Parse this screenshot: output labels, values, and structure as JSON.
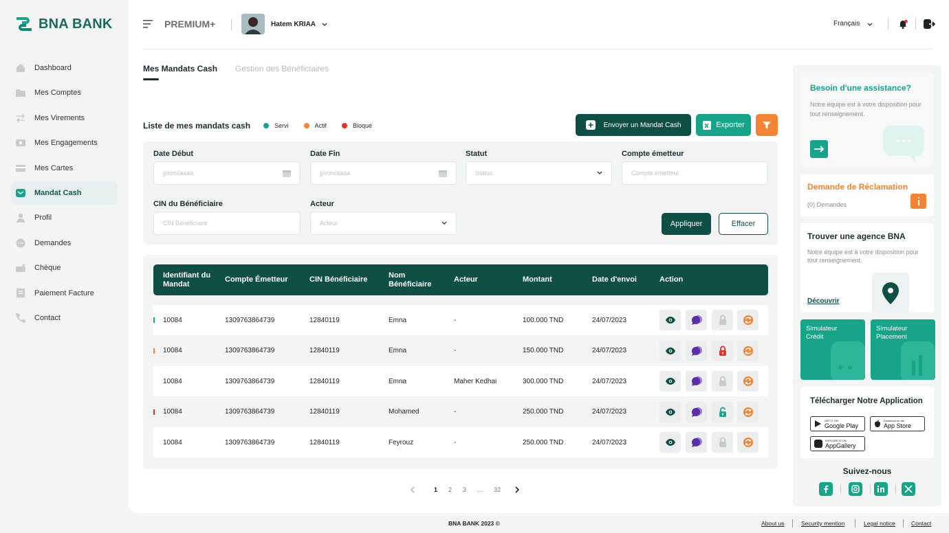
{
  "brand": {
    "name": "BNA BANK",
    "color": "#17a589",
    "dark": "#0d4f44",
    "orange": "#f28433"
  },
  "sidebar": {
    "items": [
      {
        "label": "Dashboard",
        "icon": "home-icon",
        "active": false
      },
      {
        "label": "Mes Comptes",
        "icon": "folder-icon",
        "active": false
      },
      {
        "label": "Mes Virements",
        "icon": "transfer-icon",
        "active": false
      },
      {
        "label": "Mes Engagements",
        "icon": "engagement-icon",
        "active": false
      },
      {
        "label": "Mes Cartes",
        "icon": "card-icon",
        "active": false
      },
      {
        "label": "Mandat Cash",
        "icon": "envelope-icon",
        "active": true
      },
      {
        "label": "Profil",
        "icon": "user-icon",
        "active": false
      },
      {
        "label": "Demandes",
        "icon": "chat-icon",
        "active": false
      },
      {
        "label": "Chèque",
        "icon": "cheque-icon",
        "active": false
      },
      {
        "label": "Paiement Facture",
        "icon": "invoice-icon",
        "active": false
      },
      {
        "label": "Contact",
        "icon": "phone-icon",
        "active": false
      }
    ]
  },
  "header": {
    "plan": "PREMIUM+",
    "user_name": "Hatem KRIAA",
    "language": "Français"
  },
  "tabs": [
    {
      "label": "Mes Mandats Cash",
      "active": true
    },
    {
      "label": "Gestion des Bénéficiaires",
      "active": false
    }
  ],
  "list": {
    "title": "Liste de mes mandats cash",
    "legend": [
      {
        "label": "Servi",
        "color": "#17a589"
      },
      {
        "label": "Actif",
        "color": "#f28433"
      },
      {
        "label": "Bloqué",
        "color": "#e5302f"
      }
    ],
    "send_button": "Envoyer un Mandat Cash",
    "export_button": "Exporter"
  },
  "filters": {
    "date_debut": {
      "label": "Date Début",
      "placeholder": "jj/mm/aaaa"
    },
    "date_fin": {
      "label": "Date Fin",
      "placeholder": "jj/mm/aaaa"
    },
    "statut": {
      "label": "Statut",
      "placeholder": "Status"
    },
    "compte": {
      "label": "Compte émetteur",
      "placeholder": "Compte émetteur"
    },
    "cin": {
      "label": "CIN du Bénéficiaire",
      "placeholder": "CIN Bénéficiaire"
    },
    "acteur": {
      "label": "Acteur",
      "placeholder": "Acteur"
    },
    "apply": "Appliquer",
    "clear": "Effacer"
  },
  "table": {
    "headers": [
      "Identifiant du Mandat",
      "Compte Émetteur",
      "CIN Bénéficiaire",
      "Nom Bénéficiaire",
      "Acteur",
      "Montant",
      "Date d'envoi",
      "Action"
    ],
    "rows": [
      {
        "id": "10084",
        "compte": "1309763864739",
        "cin": "12840119",
        "nom": "Emna",
        "acteur": "-",
        "montant": "100.000 TND",
        "date": "24/07/2023",
        "status": "servi",
        "lock": "disabled"
      },
      {
        "id": "10084",
        "compte": "1309763864739",
        "cin": "12840119",
        "nom": "Emna",
        "acteur": "-",
        "montant": "150.000 TND",
        "date": "24/07/2023",
        "status": "actif",
        "lock": "locked"
      },
      {
        "id": "10084",
        "compte": "1309763864739",
        "cin": "12840119",
        "nom": "Emna",
        "acteur": "Maher Kedhai",
        "montant": "300.000 TND",
        "date": "24/07/2023",
        "status": "none",
        "lock": "disabled"
      },
      {
        "id": "10084",
        "compte": "1309763864739",
        "cin": "12840119",
        "nom": "Mohamed",
        "acteur": "-",
        "montant": "250.000 TND",
        "date": "24/07/2023",
        "status": "bloque",
        "lock": "unlocked"
      },
      {
        "id": "10084",
        "compte": "1309763864739",
        "cin": "12840119",
        "nom": "Feyrouz",
        "acteur": "-",
        "montant": "250.000 TND",
        "date": "24/07/2023",
        "status": "none",
        "lock": "disabled"
      }
    ]
  },
  "pagination": {
    "pages": [
      "1",
      "2",
      "3",
      "...",
      "32"
    ],
    "current": "1"
  },
  "assist": {
    "title": "Besoin d'une assistance?",
    "text": "Notre équipe est à votre disposition pour tout renseignement."
  },
  "reclamation": {
    "title": "Demande de Réclamation",
    "count": "(0) Demandes"
  },
  "agence": {
    "title": "Trouver une agence BNA",
    "text": "Notre équipe est à votre disposition pour tout renseignement.",
    "link": "Découvrir"
  },
  "simulators": [
    {
      "label": "Simulateur Crédit"
    },
    {
      "label": "Simulateur Placement"
    }
  ],
  "app": {
    "title": "Télécharger Notre Application",
    "stores": [
      {
        "small": "GET IT ON",
        "name": "Google Play"
      },
      {
        "small": "Download on the",
        "name": "App Store"
      },
      {
        "small": "EXPLORE IT ON",
        "name": "AppGallery"
      }
    ]
  },
  "social": {
    "title": "Suivez-nous",
    "icons": [
      "facebook-icon",
      "instagram-icon",
      "linkedin-icon",
      "x-icon"
    ]
  },
  "footer": {
    "copyright": "BNA BANK 2023 ©",
    "links": [
      "About us",
      "Security mention",
      "Legal notice",
      "Contact"
    ]
  }
}
